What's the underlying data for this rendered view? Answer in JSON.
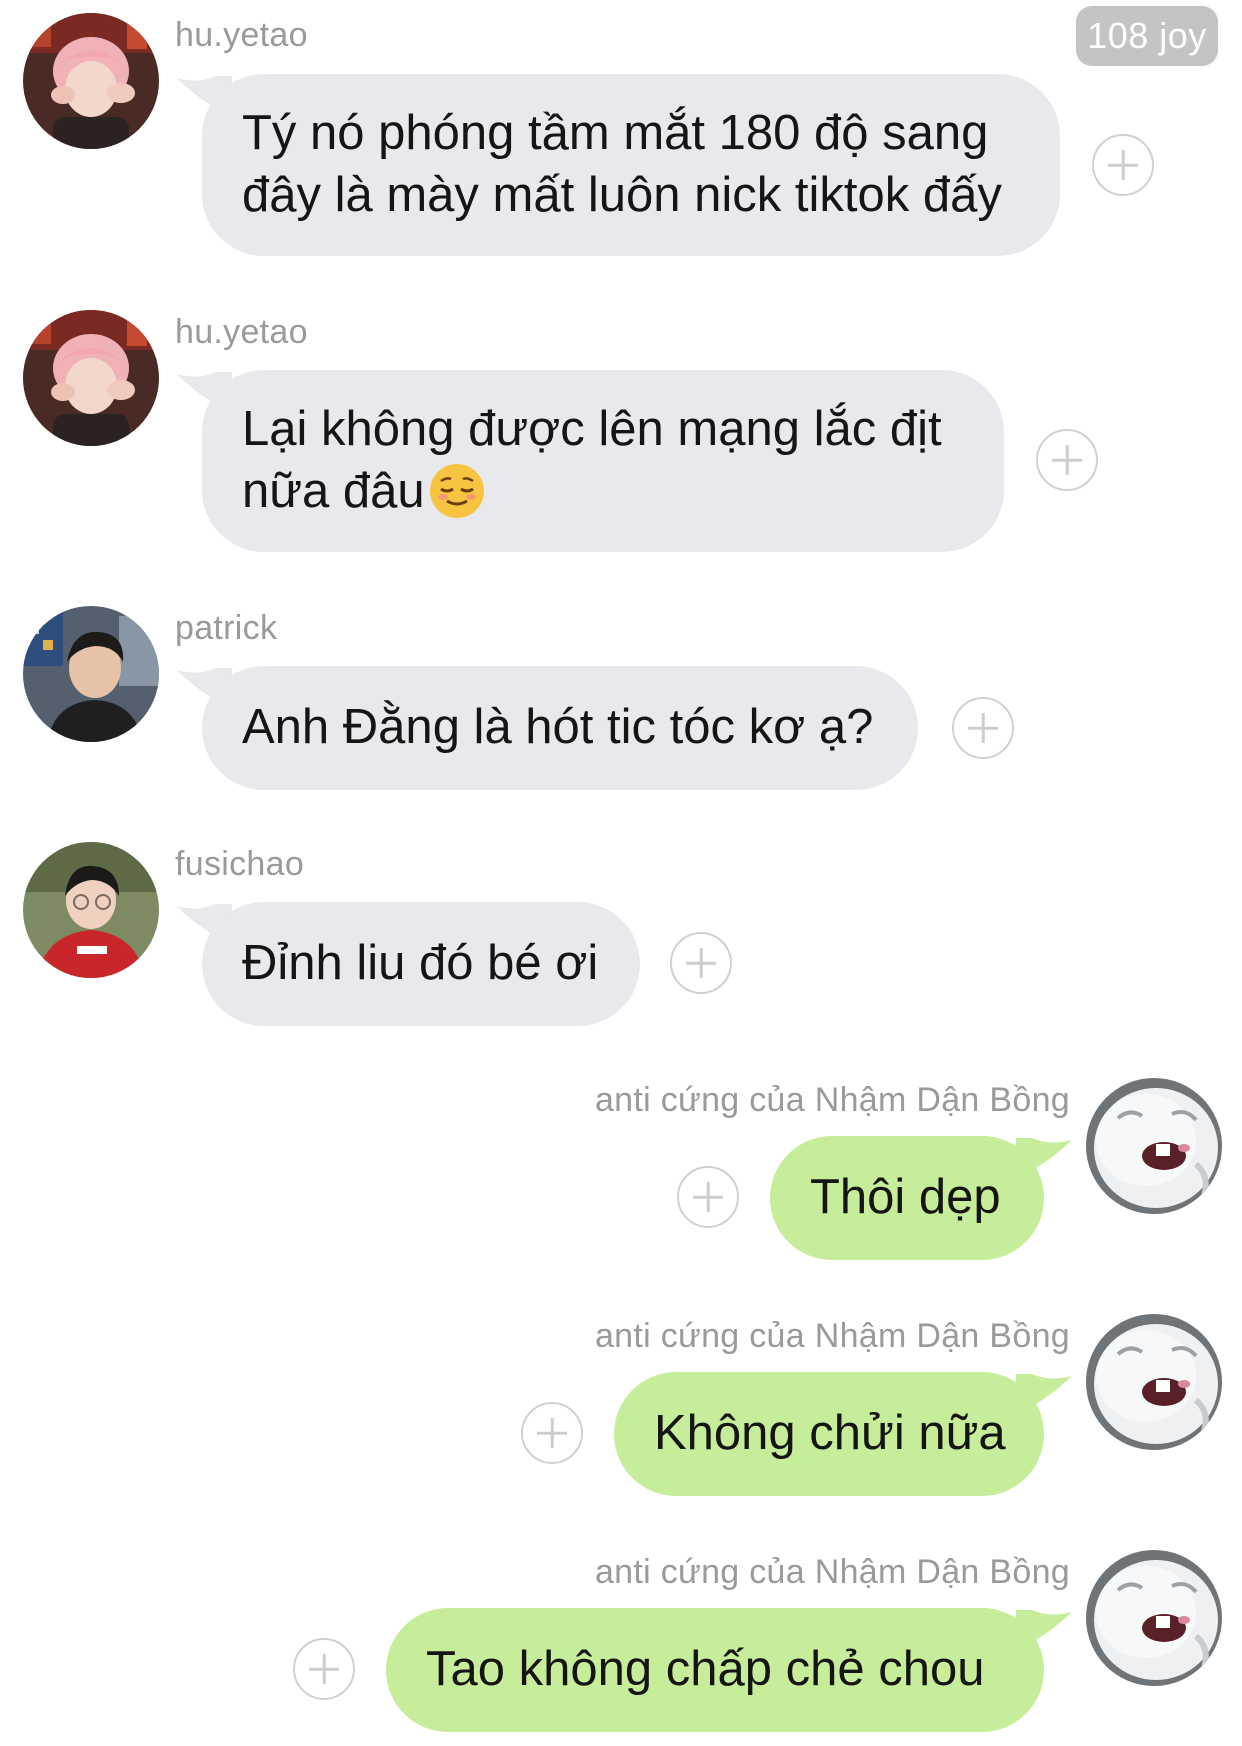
{
  "header": {
    "badge": "108 joy"
  },
  "messages": [
    {
      "sender": "hu.yetao",
      "text": "Tý nó phóng tầm mắt 180 độ sang đây là mày mất luôn nick tiktok đấy",
      "direction": "incoming",
      "avatar_icon": "pink-hair-avatar-icon"
    },
    {
      "sender": "hu.yetao",
      "text": "Lại không được lên mạng lắc địt nữa đâu",
      "emoji": "relieved-face-emoji-icon",
      "direction": "incoming",
      "avatar_icon": "pink-hair-avatar-icon"
    },
    {
      "sender": "patrick",
      "text": "Anh Đằng là hót tic tóc kơ ạ?",
      "direction": "incoming",
      "avatar_icon": "dark-hair-avatar-icon"
    },
    {
      "sender": "fusichao",
      "text": "Đỉnh liu đó bé ơi",
      "direction": "incoming",
      "avatar_icon": "red-hoodie-avatar-icon"
    },
    {
      "sender": "anti cứng của Nhậm Dận Bồng",
      "text": "Thôi dẹp",
      "direction": "outgoing",
      "avatar_icon": "white-bunny-avatar-icon"
    },
    {
      "sender": "anti cứng của Nhậm Dận Bồng",
      "text": "Không chửi nữa",
      "direction": "outgoing",
      "avatar_icon": "white-bunny-avatar-icon"
    },
    {
      "sender": "anti cứng của Nhậm Dận Bồng",
      "text": "Tao không chấp chẻ chou",
      "direction": "outgoing",
      "avatar_icon": "white-bunny-avatar-icon"
    }
  ],
  "colors": {
    "incoming_bubble": "#e7e9ec",
    "outgoing_bubble": "#c6ed9a",
    "sender_text": "#9a9a9a",
    "badge_bg": "#c4c4c4"
  }
}
